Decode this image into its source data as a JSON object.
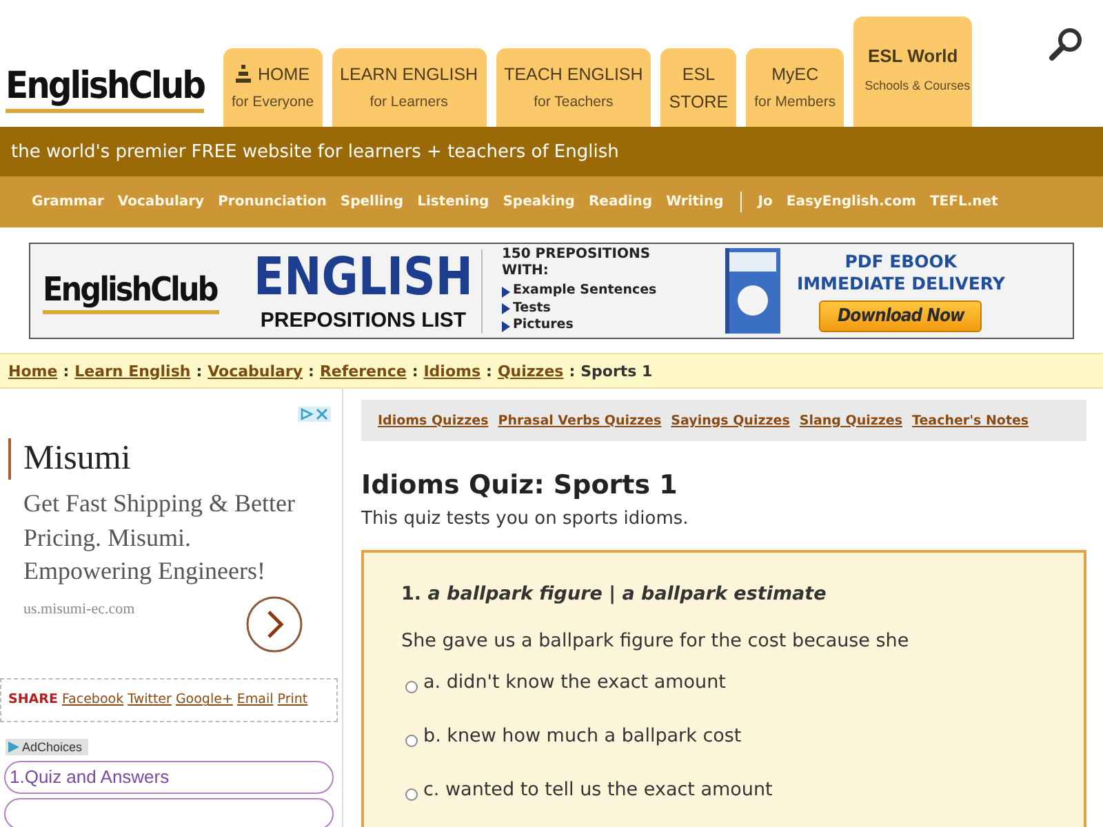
{
  "header": {
    "logo": "EnglishClub",
    "tabs": [
      {
        "kind": "home",
        "label": "HOME",
        "sub": "for Everyone"
      },
      {
        "kind": "normal",
        "label": "LEARN ENGLISH",
        "sub": "for Learners"
      },
      {
        "kind": "normal",
        "label": "TEACH ENGLISH",
        "sub": "for Teachers"
      },
      {
        "kind": "stacked",
        "label": "ESL",
        "sub": "STORE"
      },
      {
        "kind": "normal",
        "label": "MyEC",
        "sub": "for Members"
      },
      {
        "kind": "featured",
        "label": "ESL World",
        "sub": "Schools & Courses"
      }
    ]
  },
  "tagline": "the world's premier FREE website for learners + teachers of English",
  "nav": {
    "items": [
      "Grammar",
      "Vocabulary",
      "Pronunciation",
      "Spelling",
      "Listening",
      "Speaking",
      "Reading",
      "Writing"
    ],
    "external": [
      "Jo",
      "EasyEnglish.com",
      "TEFL.net"
    ]
  },
  "banner": {
    "logo": "EnglishClub",
    "title": "ENGLISH",
    "subtitle": "PREPOSITIONS LIST",
    "lead": "150 PREPOSITIONS WITH:",
    "bullets": [
      "Example Sentences",
      "Tests",
      "Pictures"
    ],
    "offer": "PDF EBOOK",
    "delivery": "IMMEDIATE DELIVERY",
    "button": "Download Now"
  },
  "breadcrumb": {
    "links": [
      "Home",
      "Learn English",
      "Vocabulary",
      "Reference",
      "Idioms",
      "Quizzes"
    ],
    "separator": ":",
    "current": "Sports 1"
  },
  "side_ad": {
    "brand": "Misumi",
    "text": "Get Fast Shipping & Better Pricing. Misumi. Empowering Engineers!",
    "url": "us.misumi-ec.com"
  },
  "share": {
    "label": "SHARE",
    "links": [
      "Facebook",
      "Twitter",
      "Google+",
      "Email",
      "Print"
    ]
  },
  "ad_links": {
    "label": "AdChoices",
    "items": [
      "1.Quiz and Answers"
    ]
  },
  "quiz_links": [
    "Idioms Quizzes",
    "Phrasal Verbs Quizzes",
    "Sayings Quizzes",
    "Slang Quizzes",
    "Teacher's Notes"
  ],
  "title": "Idioms Quiz: Sports 1",
  "intro": "This quiz tests you on sports idioms.",
  "question": {
    "heading": "1. *a ballpark figure | a ballpark estimate*",
    "prompt": "She gave us a ballpark figure for the cost because she",
    "options": [
      {
        "text": "a. didn't know the exact amount",
        "selected": false
      },
      {
        "text": "b. knew how much a ballpark cost",
        "selected": false
      },
      {
        "text": "c. wanted to tell us the exact amount",
        "selected": false
      }
    ]
  }
}
